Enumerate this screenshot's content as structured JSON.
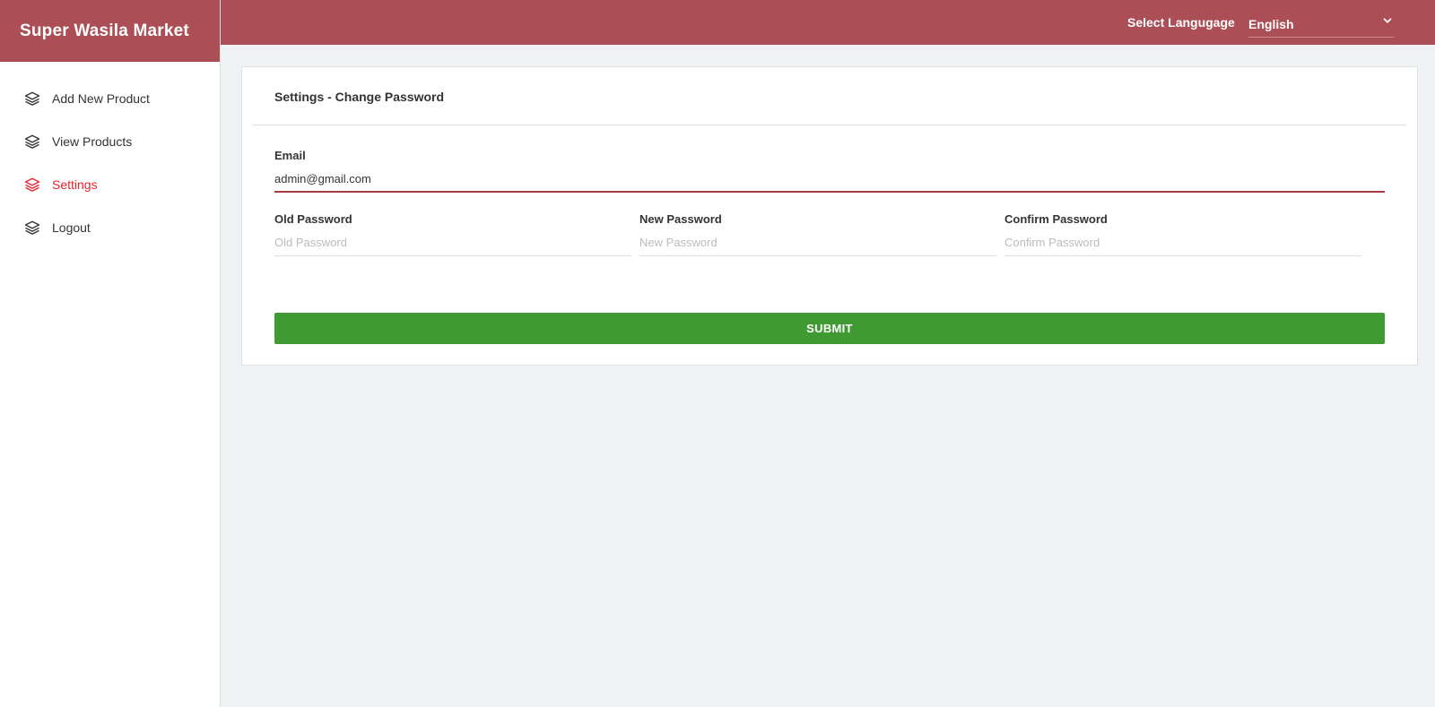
{
  "brand": {
    "title": "Super Wasila Market"
  },
  "sidebar": {
    "items": [
      {
        "label": "Add New Product",
        "icon": "layers-icon"
      },
      {
        "label": "View Products",
        "icon": "layers-icon"
      },
      {
        "label": "Settings",
        "icon": "layers-icon",
        "active": true
      },
      {
        "label": "Logout",
        "icon": "layers-icon"
      }
    ]
  },
  "header": {
    "language_label": "Select Langugage",
    "language_value": "English"
  },
  "settings": {
    "title": "Settings - Change Password",
    "email_label": "Email",
    "email_value": "admin@gmail.com",
    "old_password_label": "Old Password",
    "old_password_placeholder": "Old Password",
    "new_password_label": "New Password",
    "new_password_placeholder": "New Password",
    "confirm_password_label": "Confirm Password",
    "confirm_password_placeholder": "Confirm Password",
    "submit_label": "SUBMIT"
  },
  "colors": {
    "brand": "#ab4e55",
    "active_nav": "#e8242f",
    "submit": "#3f9a34",
    "email_underline": "#a83a42"
  }
}
